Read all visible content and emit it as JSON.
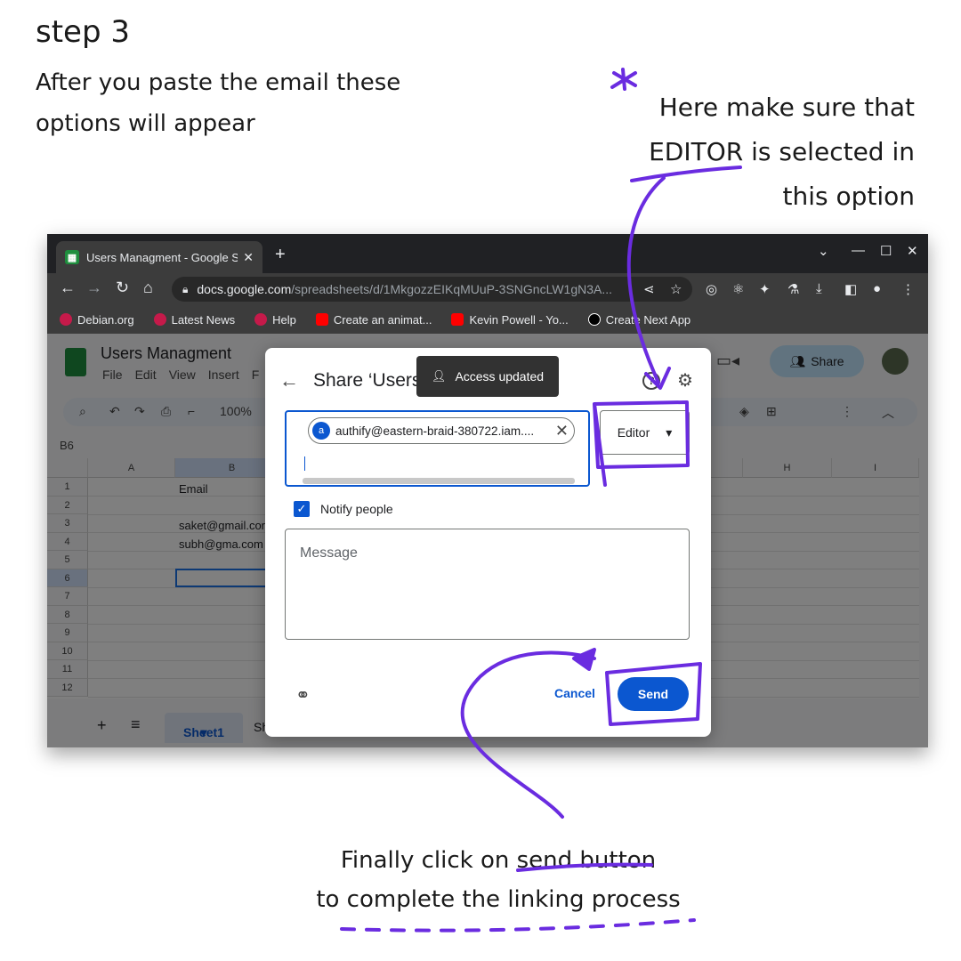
{
  "annotations": {
    "step_title": "step 3",
    "step_desc": "After you paste the email these options will appear",
    "note": "Here make sure that EDITOR is selected  in this option",
    "bottom_line1": "Finally click on send button",
    "bottom_line2": "to complete the linking process",
    "accent_color": "#6a2ce0"
  },
  "browser": {
    "tab_title": "Users Managment - Google S",
    "url_domain": "docs.google.com",
    "url_path": "/spreadsheets/d/1MkgozzEIKqMUuP-3SNGncLW1gN3A...",
    "bookmarks": [
      "Debian.org",
      "Latest News",
      "Help",
      "Create an animat...",
      "Kevin Powell - Yo...",
      "Create Next App"
    ]
  },
  "sheets": {
    "doc_title": "Users Managment",
    "menu": [
      "File",
      "Edit",
      "View",
      "Insert",
      "F"
    ],
    "zoom": "100%",
    "name_box": "B6",
    "share_label": "Share",
    "columns": [
      "A",
      "B",
      "H",
      "I"
    ],
    "rows": [
      "1",
      "2",
      "3",
      "4",
      "5",
      "6",
      "7",
      "8",
      "9",
      "10",
      "11",
      "12"
    ],
    "cells": {
      "b1": "Email",
      "b3": "saket@gmail.cor",
      "b4": "subh@gma.com"
    },
    "sheet_tab": "Sheet1",
    "sheet_tab2": "Sh"
  },
  "dialog": {
    "title": "Share ‘Users",
    "toast": "Access updated",
    "chip_initial": "a",
    "chip_email": "authify@eastern-braid-380722.iam....",
    "role": "Editor",
    "notify_label": "Notify people",
    "message_placeholder": "Message",
    "cancel_label": "Cancel",
    "send_label": "Send"
  }
}
